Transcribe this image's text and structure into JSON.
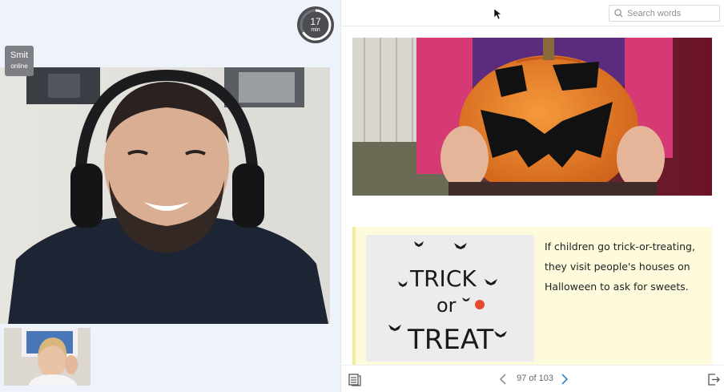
{
  "timer": {
    "value": "17",
    "unit": "min"
  },
  "participant": {
    "name": "Smit",
    "status": "online"
  },
  "search": {
    "placeholder": "Search words"
  },
  "reader": {
    "card_text": "If children go trick-or-treating, they visit people's houses on Halloween to ask for sweets.",
    "card_image_words": [
      "TRICK",
      "or",
      "TREAT"
    ]
  },
  "pagination": {
    "label": "97 of 103"
  },
  "colors": {
    "accent": "#3b82c4",
    "card_bg": "#fdfbdc",
    "timer_bg": "#4b4d52"
  },
  "icons": {
    "timer": "timer-ring-icon",
    "search": "search-icon",
    "prev": "chevron-left-icon",
    "next": "chevron-right-icon",
    "contents": "contents-icon",
    "exit": "exit-icon"
  }
}
